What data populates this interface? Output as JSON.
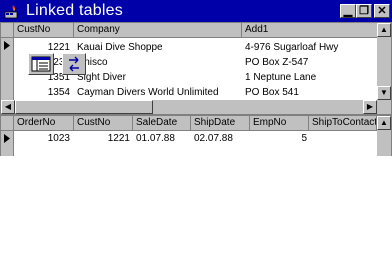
{
  "window": {
    "title": "Linked tables"
  },
  "titlebar_buttons": {
    "minimize": "▁",
    "maximize": "❐",
    "close": "✕"
  },
  "customers": {
    "columns": [
      "CustNo",
      "Company",
      "Add1"
    ],
    "rows": [
      {
        "custno": "1221",
        "company": "Kauai Dive Shoppe",
        "add1": "4-976 Sugarloaf Hwy"
      },
      {
        "custno": "1231",
        "company": "Unisco",
        "add1": "PO Box Z-547"
      },
      {
        "custno": "1351",
        "company": "Sight Diver",
        "add1": "1 Neptune Lane"
      },
      {
        "custno": "1354",
        "company": "Cayman Divers World Unlimited",
        "add1": "PO Box 541"
      }
    ]
  },
  "orders": {
    "columns": [
      "OrderNo",
      "CustNo",
      "SaleDate",
      "ShipDate",
      "EmpNo",
      "ShipToContact"
    ],
    "rows": [
      {
        "orderno": "1023",
        "custno": "1221",
        "saledate": "01.07.88",
        "shipdate": "02.07.88",
        "empno": "5"
      }
    ]
  },
  "colors": {
    "titlebar": "#0000a8",
    "face": "#c0c0c0"
  }
}
